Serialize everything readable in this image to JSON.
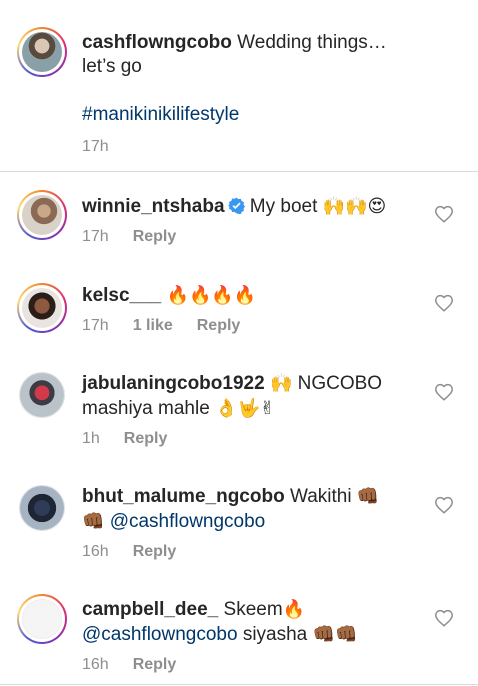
{
  "caption": {
    "username": "cashflowngcobo",
    "text_line1": " Wedding things…",
    "text_line2": "let’s go",
    "hashtag": "#manikinikilifestyle",
    "time": "17h"
  },
  "comments": [
    {
      "username": "winnie_ntshaba",
      "verified": true,
      "text": " My boet ",
      "emojis": "🙌🙌😍",
      "time": "17h",
      "likes": "",
      "reply_label": "Reply"
    },
    {
      "username": "kelsc___",
      "text": " ",
      "emojis": "🔥🔥🔥🔥",
      "time": "17h",
      "likes": "1 like",
      "reply_label": "Reply"
    },
    {
      "username": "jabulaningcobo1922",
      "text": " ",
      "emojis_inline": "🙌",
      "text_after": " NGCOBO",
      "text_line2": "mashiya mahle ",
      "emojis_line2": "👌🤟✌",
      "time": "1h",
      "likes": "",
      "reply_label": "Reply"
    },
    {
      "username": "bhut_malume_ngcobo",
      "text": " Wakithi ",
      "emojis": "👊🏾",
      "line2_emoji": "👊🏾",
      "mention": "@cashflowngcobo",
      "time": "16h",
      "likes": "",
      "reply_label": "Reply"
    },
    {
      "username": "campbell_dee_",
      "text": " Skeem",
      "emojis": "🔥",
      "mention": "@cashflowngcobo",
      "text_after": " siyasha ",
      "emojis_line2": "👊🏾👊🏾",
      "time": "16h",
      "likes": "",
      "reply_label": "Reply"
    }
  ],
  "icons": {
    "like": "heart-outline-icon",
    "verified": "verified-badge-icon"
  },
  "colors": {
    "text": "#262626",
    "meta": "#8e8e8e",
    "link": "#00376b",
    "verified": "#3897f0"
  }
}
